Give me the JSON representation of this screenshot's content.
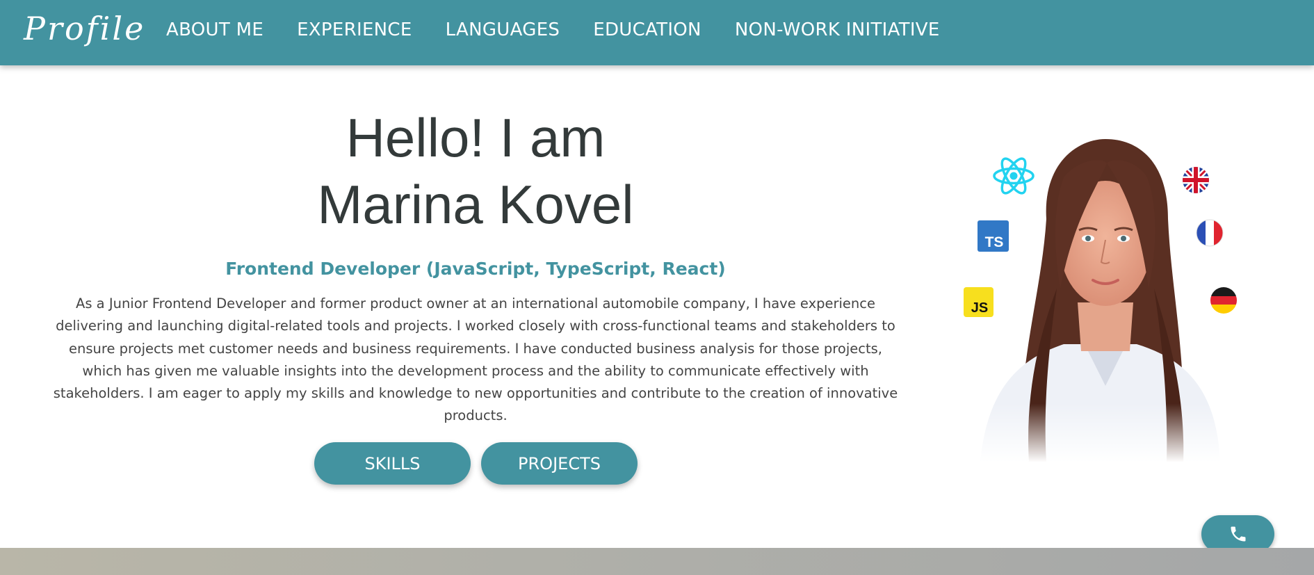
{
  "header": {
    "logo": "Profile",
    "nav": [
      {
        "label": "ABOUT ME"
      },
      {
        "label": "EXPERIENCE"
      },
      {
        "label": "LANGUAGES"
      },
      {
        "label": "EDUCATION"
      },
      {
        "label": "NON-WORK INITIATIVE"
      }
    ]
  },
  "hero": {
    "title_line1": "Hello! I am",
    "title_line2": "Marina Kovel",
    "subtitle": "Frontend Developer (JavaScript, TypeScript, React)",
    "bio_lines": [
      "As a Junior Frontend Developer and former product owner at an international automobile company, I have experience",
      "delivering and launching digital-related tools and projects. I worked closely with cross-functional teams and stakeholders to",
      "ensure projects met customer needs and business requirements. I have conducted business analysis for those projects,",
      "which has given me valuable insights into the development process and the ability to communicate effectively with",
      "stakeholders. I am eager to apply my skills and knowledge to new opportunities and contribute to the creation of innovative",
      "products."
    ],
    "buttons": {
      "skills": "SKILLS",
      "projects": "PROJECTS"
    }
  },
  "portrait": {
    "tech_icons": {
      "react": "react-icon",
      "typescript": "TS",
      "javascript": "JS"
    },
    "language_flags": [
      "uk-flag-icon",
      "france-flag-icon",
      "germany-flag-icon"
    ]
  },
  "colors": {
    "primary": "#4393a0",
    "text_dark": "#333a3a",
    "text_body": "#444444",
    "js_yellow": "#f7df1e",
    "ts_blue": "#3178c6",
    "react_cyan": "#22d3f0"
  }
}
